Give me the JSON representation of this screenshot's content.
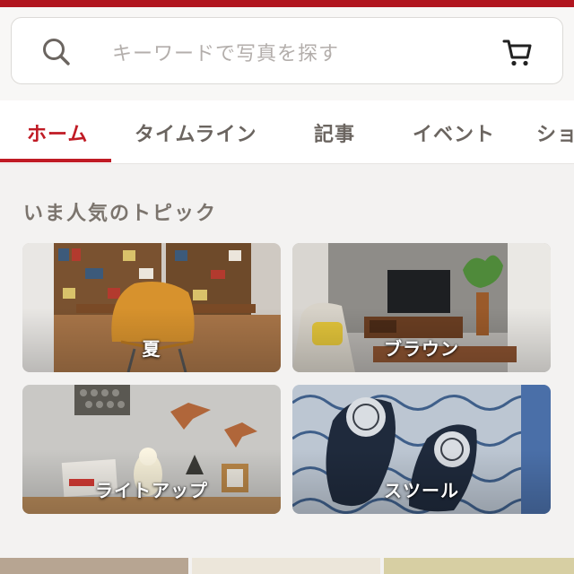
{
  "search": {
    "placeholder": "キーワードで写真を探す"
  },
  "tabs": [
    {
      "label": "ホーム",
      "active": true
    },
    {
      "label": "タイムライン",
      "active": false
    },
    {
      "label": "記事",
      "active": false
    },
    {
      "label": "イベント",
      "active": false
    },
    {
      "label": "ショ",
      "active": false
    }
  ],
  "section": {
    "title": "いま人気のトピック"
  },
  "topics": [
    {
      "label": "夏",
      "photo": "bookshelf-chair-photo"
    },
    {
      "label": "ブラウン",
      "photo": "living-room-tv-photo"
    },
    {
      "label": "ライトアップ",
      "photo": "bird-wall-lamp-photo"
    },
    {
      "label": "スツール",
      "photo": "slippers-rug-photo"
    }
  ],
  "colors": {
    "brand_red": "#c01b25",
    "tab_text": "#6b6560",
    "placeholder": "#b3aeab"
  },
  "icons": [
    "search-icon",
    "cart-icon"
  ]
}
